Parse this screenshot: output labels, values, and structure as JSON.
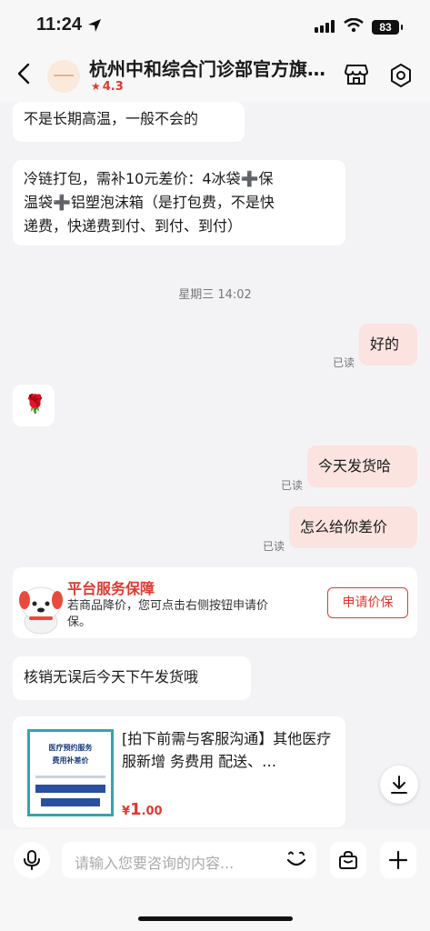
{
  "status": {
    "time": "11:24",
    "battery": "83"
  },
  "header": {
    "shop_name": "杭州中和综合门诊部官方旗舰店",
    "rating": "4.3"
  },
  "messages": {
    "m1": "不是长期高温，一般不会的",
    "m2_line1": "冷链打包，需补10元差价：4冰袋➕保",
    "m2_line2": "温袋➕铝塑泡沫箱（是打包费，不是快",
    "m2_line3": "递费，快递费到付、到付、到付）",
    "timestamp": "星期三 14:02",
    "m3": "好的",
    "m4_emoji": "🌹",
    "m5": "今天发货哈",
    "m6": "怎么给你差价",
    "read_label": "已读",
    "m7": "核销无误后今天下午发货哦"
  },
  "guarantee": {
    "title": "平台服务保障",
    "desc": "若商品降价，您可点击右侧按钮申请价保。",
    "button": "申请价保"
  },
  "product": {
    "thumb_title": "医疗预约服务",
    "thumb_sub": "费用补差价",
    "title": "[拍下前需与客服沟通】其他医疗服新增 务费用 配送、…",
    "currency": "¥",
    "price_int": "1",
    "price_dec": ".00"
  },
  "input": {
    "placeholder": "请输入您要咨询的内容..."
  }
}
